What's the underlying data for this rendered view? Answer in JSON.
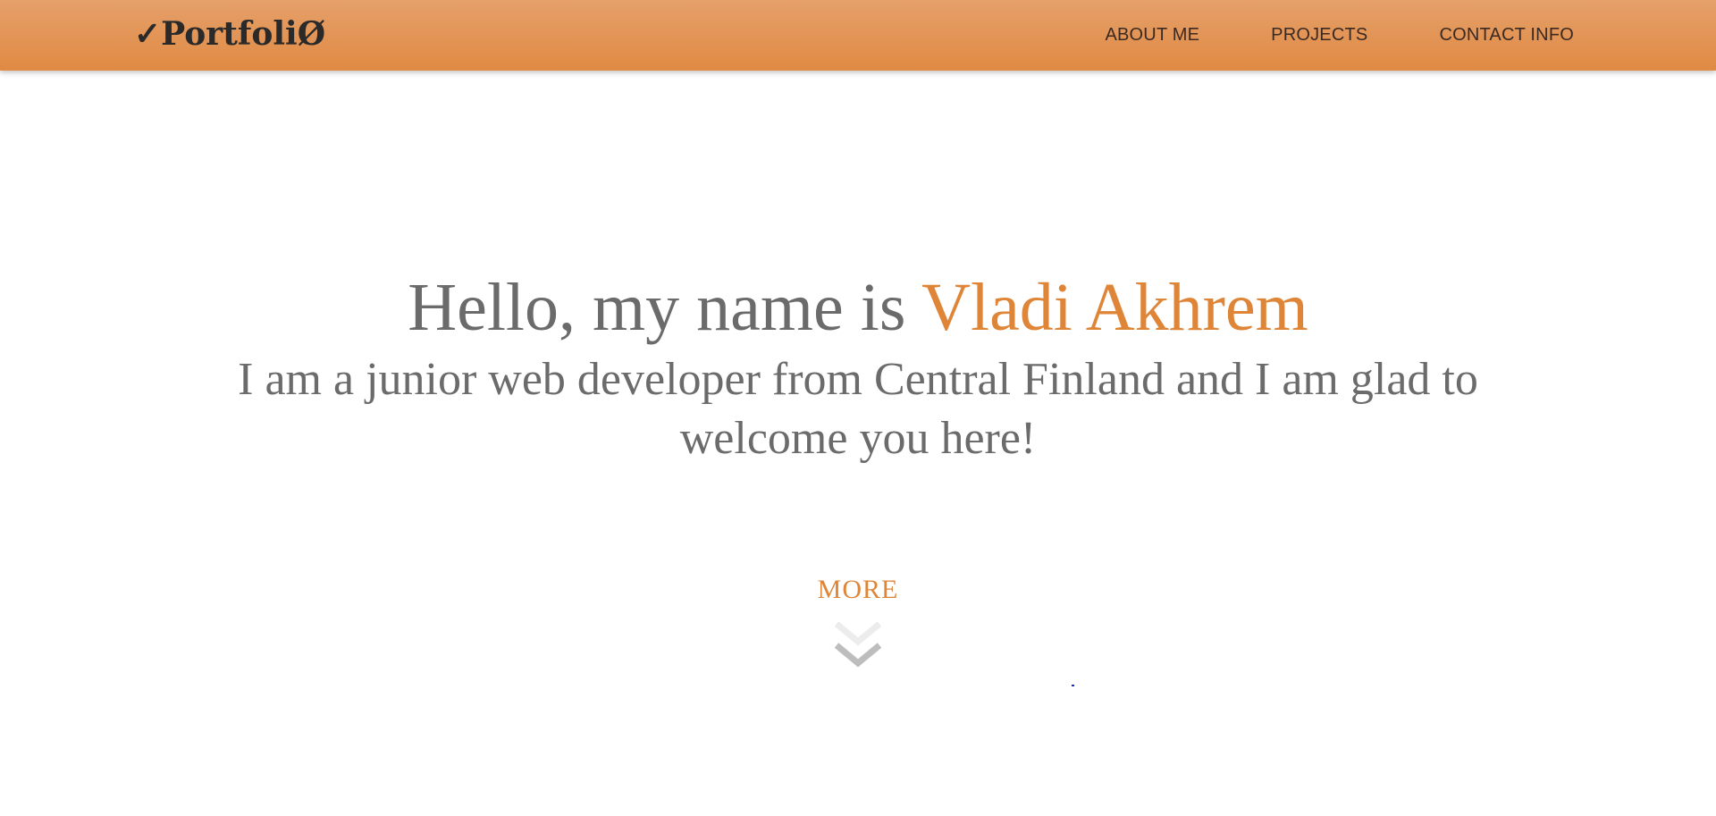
{
  "header": {
    "logo": "✓PortfoliØ",
    "nav": [
      {
        "label": "ABOUT ME"
      },
      {
        "label": "PROJECTS"
      },
      {
        "label": "CONTACT INFO"
      }
    ]
  },
  "hero": {
    "greeting": "Hello, my name is ",
    "name": "Vladi Akhrem",
    "subtitle": "I am a junior web developer from Central Finland and I am glad to welcome you here!",
    "more_label": "MORE"
  },
  "colors": {
    "accent": "#df8538",
    "header_top": "#e5a06a",
    "header_bottom": "#e08a43",
    "text_gray": "#6b6b6b",
    "chevron": "#bdbdbd"
  },
  "icons": {
    "more": "double-chevron-down-icon"
  }
}
